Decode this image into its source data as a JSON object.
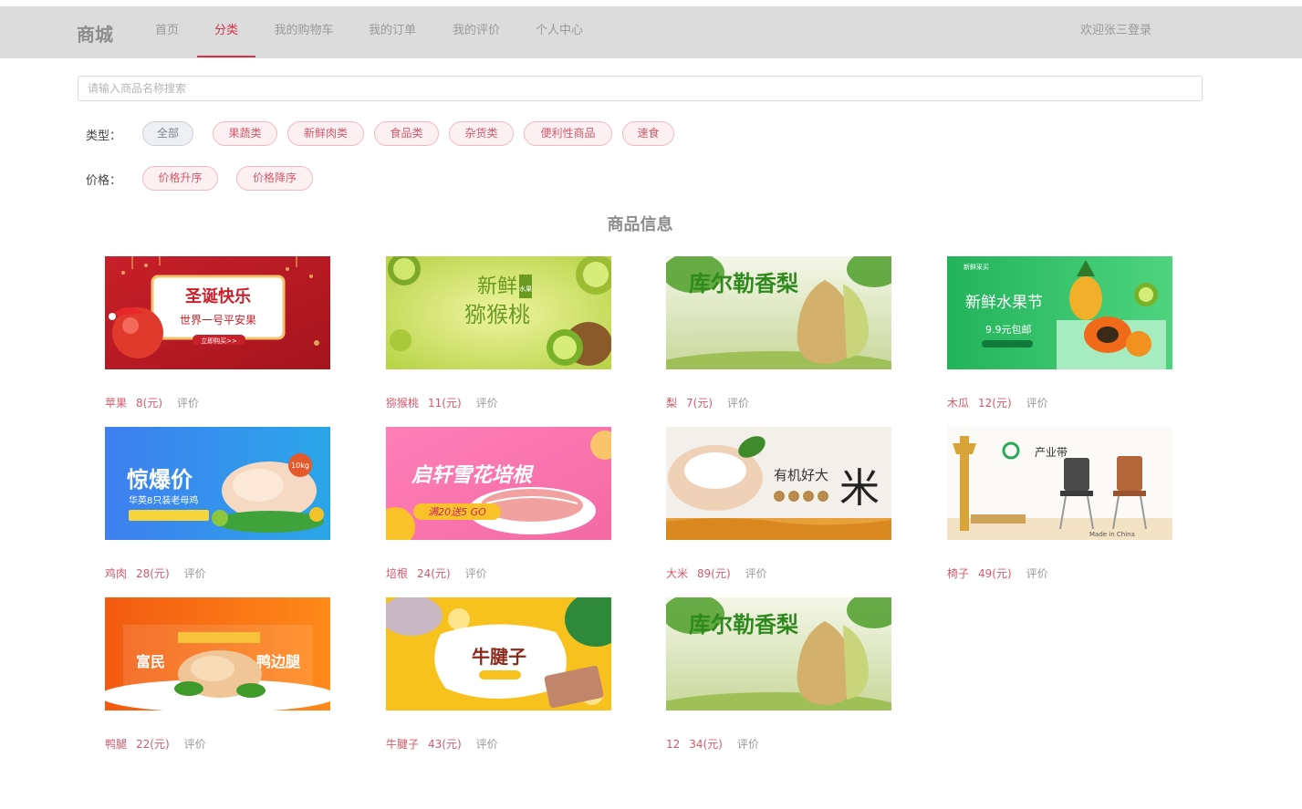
{
  "nav": {
    "logo": "商城",
    "items": [
      {
        "label": "首页"
      },
      {
        "label": "分类"
      },
      {
        "label": "我的购物车"
      },
      {
        "label": "我的订单"
      },
      {
        "label": "我的评价"
      },
      {
        "label": "个人中心"
      }
    ],
    "active_index": 1,
    "welcome": "欢迎张三登录"
  },
  "search": {
    "placeholder": "请输入商品名称搜索",
    "value": ""
  },
  "filters": {
    "type_label": "类型：",
    "types": [
      "全部",
      "果蔬类",
      "新鲜肉类",
      "食品类",
      "杂货类",
      "便利性商品",
      "速食"
    ],
    "price_label": "价格：",
    "prices": [
      "价格升序",
      "价格降序"
    ]
  },
  "section_title": "商品信息",
  "products": [
    {
      "name": "苹果",
      "price": "8(元)",
      "review": "评价",
      "banner_text": [
        "圣诞快乐",
        "世界一号平安果",
        "立即购买>>"
      ]
    },
    {
      "name": "猕猴桃",
      "price": "11(元)",
      "review": "评价",
      "banner_text": [
        "新鲜",
        "猕猴桃",
        "水果"
      ]
    },
    {
      "name": "梨",
      "price": "7(元)",
      "review": "评价",
      "banner_text": [
        "库尔勒香梨"
      ]
    },
    {
      "name": "木瓜",
      "price": "12(元)",
      "review": "评价",
      "banner_text": [
        "新鲜采买",
        "新鲜水果节",
        "9.9元包邮"
      ]
    },
    {
      "name": "鸡肉",
      "price": "28(元)",
      "review": "评价",
      "banner_text": [
        "惊爆价",
        "华英8只装老母鸡",
        "10kg"
      ]
    },
    {
      "name": "培根",
      "price": "24(元)",
      "review": "评价",
      "banner_text": [
        "启轩雪花培根",
        "满20送5 GO"
      ]
    },
    {
      "name": "大米",
      "price": "89(元)",
      "review": "评价",
      "banner_text": [
        "有机好大",
        "米"
      ]
    },
    {
      "name": "椅子",
      "price": "49(元)",
      "review": "评价",
      "banner_text": [
        "产业带",
        "Made in China"
      ]
    },
    {
      "name": "鸭腿",
      "price": "22(元)",
      "review": "评价",
      "banner_text": [
        "富民",
        "鸭边腿"
      ]
    },
    {
      "name": "牛腱子",
      "price": "43(元)",
      "review": "评价",
      "banner_text": [
        "牛腱子"
      ]
    },
    {
      "name": "12",
      "price": "34(元)",
      "review": "评价",
      "banner_text": [
        "库尔勒香梨"
      ]
    }
  ],
  "colors": {
    "accent": "#d2334b",
    "nav_bg": "#dcdcdc",
    "chip_bg": "#fdf0f2",
    "chip_border": "#f0b9c0"
  }
}
